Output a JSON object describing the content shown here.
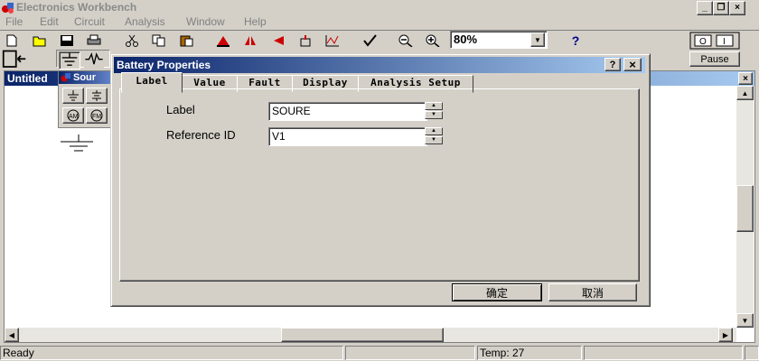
{
  "app": {
    "title": "Electronics Workbench"
  },
  "menu": [
    {
      "label": "File"
    },
    {
      "label": "Edit"
    },
    {
      "label": "Circuit"
    },
    {
      "label": "Analysis"
    },
    {
      "label": "Window"
    },
    {
      "label": "Help"
    }
  ],
  "toolbar": {
    "zoom": "80%",
    "help_label": "?",
    "pause_label": "Pause"
  },
  "circuit_window": {
    "title": "Untitled"
  },
  "parts_bin": {
    "title": "Sour"
  },
  "dialog": {
    "title": "Battery Properties",
    "help_btn": "?",
    "close_btn": "×",
    "tabs": [
      {
        "label": "Label"
      },
      {
        "label": "Value"
      },
      {
        "label": "Fault"
      },
      {
        "label": "Display"
      },
      {
        "label": "Analysis Setup"
      }
    ],
    "fields": {
      "label_caption": "Label",
      "label_value": "SOURE",
      "ref_caption": "Reference ID",
      "ref_value": "V1"
    },
    "ok_label": "确定",
    "cancel_label": "取消"
  },
  "status": {
    "ready": "Ready",
    "temp": "Temp:  27"
  }
}
